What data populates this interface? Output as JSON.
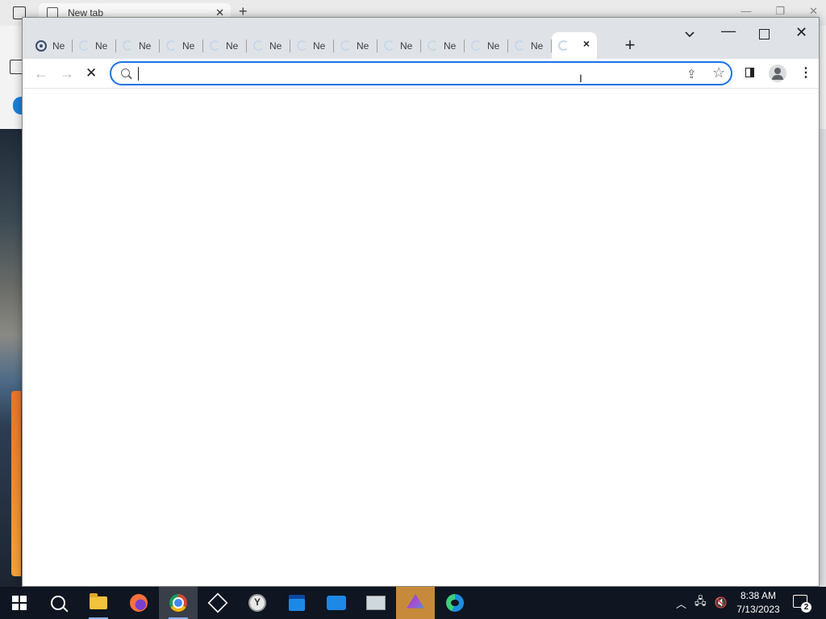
{
  "background_window": {
    "tab_label": "New tab"
  },
  "browser": {
    "tabs": [
      {
        "label": "Ne",
        "icon": "site-icon"
      },
      {
        "label": "Ne",
        "icon": "loading-spinner-icon"
      },
      {
        "label": "Ne",
        "icon": "loading-spinner-icon"
      },
      {
        "label": "Ne",
        "icon": "loading-spinner-icon"
      },
      {
        "label": "Ne",
        "icon": "loading-spinner-icon"
      },
      {
        "label": "Ne",
        "icon": "loading-spinner-icon"
      },
      {
        "label": "Ne",
        "icon": "loading-spinner-icon"
      },
      {
        "label": "Ne",
        "icon": "loading-spinner-icon"
      },
      {
        "label": "Ne",
        "icon": "loading-spinner-icon"
      },
      {
        "label": "Ne",
        "icon": "loading-spinner-icon"
      },
      {
        "label": "Ne",
        "icon": "loading-spinner-icon"
      },
      {
        "label": "Ne",
        "icon": "loading-spinner-icon"
      }
    ],
    "active_tab": {
      "icon": "loading-spinner-icon",
      "close": "×"
    },
    "new_tab": "+",
    "address": {
      "value": ""
    },
    "accent_color": "#1a73e8"
  },
  "taskbar": {
    "items": [
      {
        "name": "start-button",
        "icon": "windows-icon"
      },
      {
        "name": "search-button",
        "icon": "search-icon"
      },
      {
        "name": "file-explorer",
        "icon": "folder-icon"
      },
      {
        "name": "firefox",
        "icon": "firefox-icon"
      },
      {
        "name": "chrome",
        "icon": "chrome-icon"
      },
      {
        "name": "3d-viewer",
        "icon": "cube-icon"
      },
      {
        "name": "clock-app",
        "icon": "clock-icon"
      },
      {
        "name": "calendar",
        "icon": "calendar-icon"
      },
      {
        "name": "people",
        "icon": "people-icon"
      },
      {
        "name": "monitor-app",
        "icon": "monitor-icon"
      },
      {
        "name": "prism-app",
        "icon": "prism-icon"
      },
      {
        "name": "edge",
        "icon": "edge-icon"
      }
    ],
    "time": "8:38 AM",
    "date": "7/13/2023",
    "notification_count": "2"
  }
}
